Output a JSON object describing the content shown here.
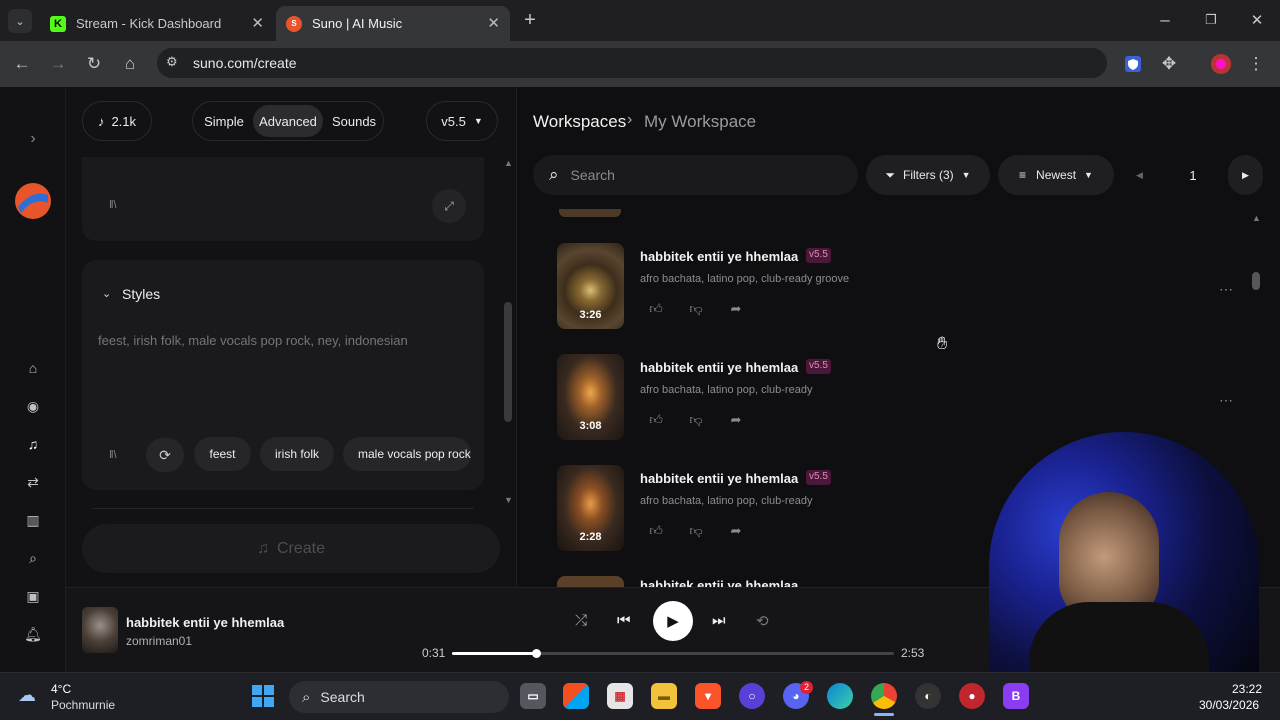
{
  "browser": {
    "tabs": [
      {
        "title": "Stream - Kick Dashboard",
        "favicon": "K"
      },
      {
        "title": "Suno | AI Music",
        "favicon": "S"
      }
    ],
    "url": "suno.com/create",
    "accent": "#53fc18"
  },
  "left": {
    "credits": "2.1k",
    "modes": [
      "Simple",
      "Advanced",
      "Sounds"
    ],
    "active_mode": "Advanced",
    "version": "v5.5",
    "styles_heading": "Styles",
    "styles_text": "feest, irish folk, male vocals pop rock, ney, indonesian",
    "chips": [
      "feest",
      "irish folk",
      "male vocals pop rock"
    ],
    "create_label": "Create"
  },
  "right": {
    "breadcrumb_root": "Workspaces",
    "breadcrumb_current": "My Workspace",
    "search_placeholder": "Search",
    "filters_label": "Filters (3)",
    "sort_label": "Newest",
    "page": "1",
    "songs": [
      {
        "title": "habbitek entii ye hhemlaa",
        "badge": "v5.5",
        "tags": "afro bachata, latino pop, club-ready groove",
        "duration": "3:26"
      },
      {
        "title": "habbitek entii ye hhemlaa",
        "badge": "v5.5",
        "tags": "afro bachata, latino pop, club-ready",
        "duration": "3:08"
      },
      {
        "title": "habbitek entii ye hhemlaa",
        "badge": "v5.5",
        "tags": "afro bachata, latino pop, club-ready",
        "duration": "2:28"
      }
    ],
    "partial_song_title": "habbitek entii ye hhemlaa"
  },
  "player": {
    "title": "habbitek entii ye hhemlaa",
    "artist": "zomriman01",
    "elapsed": "0:31",
    "total": "2:53",
    "progress": 0.19
  },
  "taskbar": {
    "temperature": "4°C",
    "weather": "Pochmurnie",
    "search_label": "Search",
    "time": "23:22",
    "date": "30/03/2026",
    "discord_badge": "2"
  }
}
